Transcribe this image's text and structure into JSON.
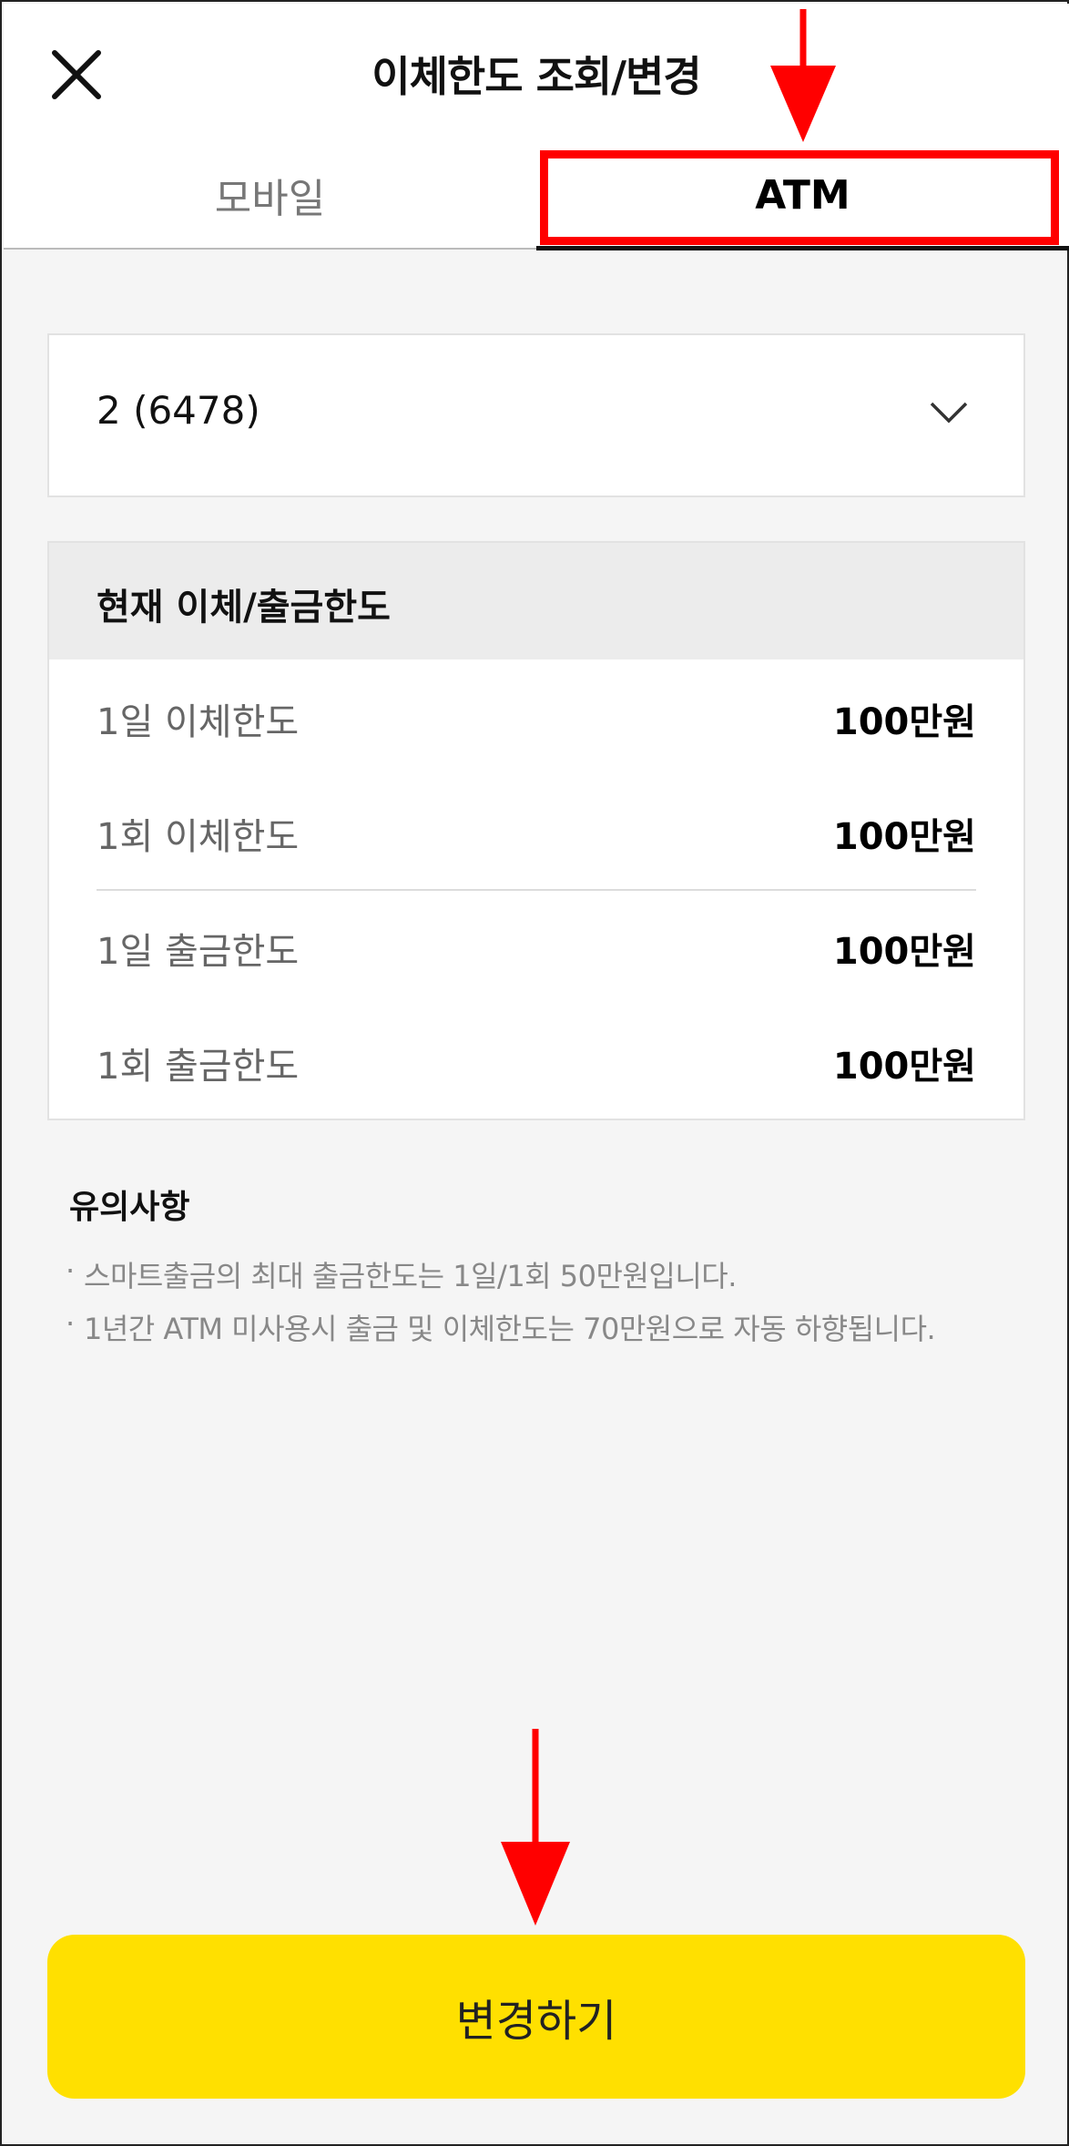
{
  "header": {
    "title": "이체한도 조회/변경",
    "close_icon": "close-icon"
  },
  "tabs": [
    {
      "label": "모바일",
      "active": false
    },
    {
      "label": "ATM",
      "active": true
    }
  ],
  "account": {
    "selected": "2 (6478)",
    "icon": "chevron-down-icon"
  },
  "limits": {
    "heading": "현재 이체/출금한도",
    "rows": [
      {
        "label": "1일 이체한도",
        "value": "100만원"
      },
      {
        "label": "1회 이체한도",
        "value": "100만원"
      },
      {
        "label": "1일 출금한도",
        "value": "100만원"
      },
      {
        "label": "1회 출금한도",
        "value": "100만원"
      }
    ]
  },
  "notes": {
    "title": "유의사항",
    "items": [
      "스마트출금의 최대 출금한도는 1일/1회 50만원입니다.",
      "1년간 ATM 미사용시 출금 및 이체한도는 70만원으로 자동 하향됩니다."
    ]
  },
  "actions": {
    "change_label": "변경하기"
  },
  "colors": {
    "accent": "#ffe000",
    "highlight": "#ff0000",
    "background": "#f5f5f5"
  }
}
